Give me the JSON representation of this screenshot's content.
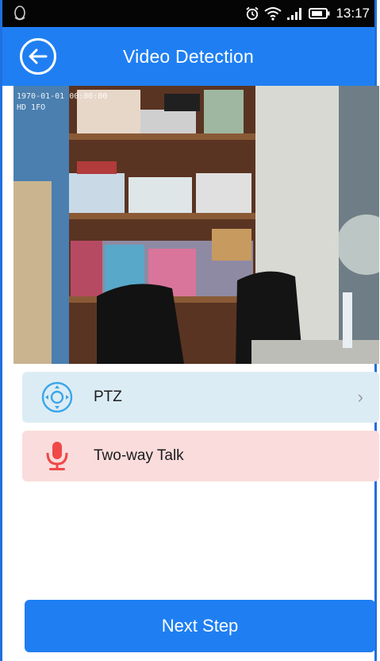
{
  "status_bar": {
    "time": "13:17",
    "icons": [
      "qq-penguin-icon",
      "alarm-icon",
      "wifi-icon",
      "signal-icon",
      "battery-icon"
    ]
  },
  "app_bar": {
    "title": "Video Detection",
    "back_icon": "back-arrow-circle-icon"
  },
  "video": {
    "osd_timestamp": "1970-01-01 00:00:00",
    "osd_quality": "HD 1FO"
  },
  "options": [
    {
      "label": "PTZ",
      "icon": "ptz-dpad-icon",
      "chevron": "›"
    },
    {
      "label": "Two-way Talk",
      "icon": "microphone-icon"
    }
  ],
  "footer": {
    "next_label": "Next Step"
  },
  "colors": {
    "primary": "#1f7ff2",
    "ptz_row": "#dcecf5",
    "talk_row": "#fadcdc",
    "mic_red": "#f04848",
    "ptz_blue": "#3aa6e8"
  }
}
